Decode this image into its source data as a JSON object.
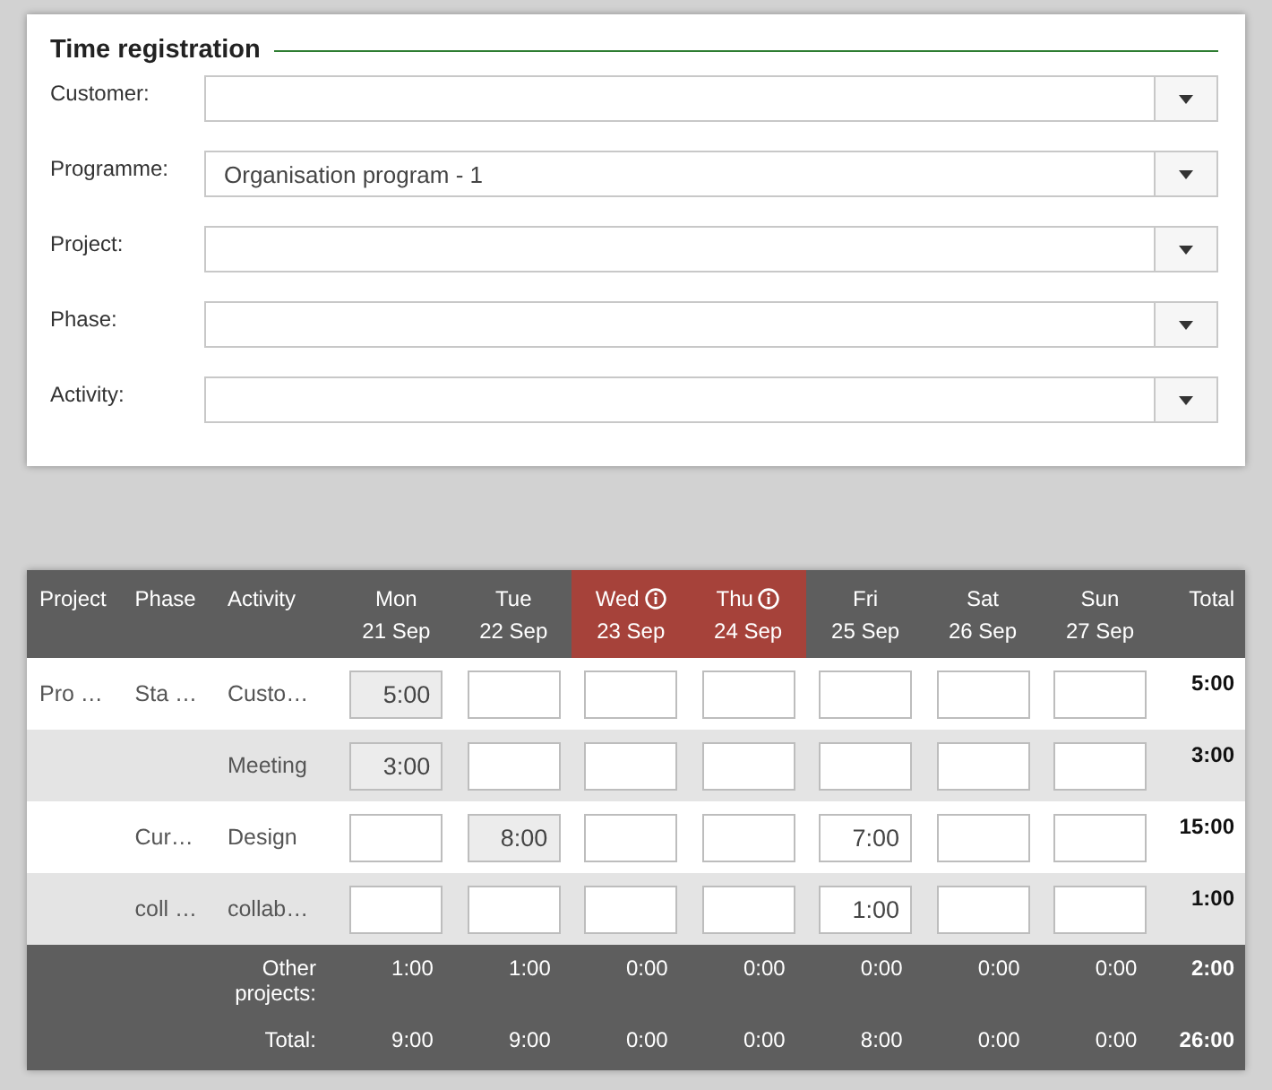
{
  "form": {
    "title": "Time registration",
    "fields": [
      {
        "label": "Customer:"
      },
      {
        "label": "Programme:",
        "value": "Organisation program - 1"
      },
      {
        "label": "Project:"
      },
      {
        "label": "Phase:"
      },
      {
        "label": "Activity:"
      }
    ]
  },
  "table": {
    "columns": {
      "project": "Project",
      "phase": "Phase",
      "activity": "Activity",
      "total": "Total"
    },
    "days": [
      {
        "day": "Mon",
        "date": "21 Sep",
        "highlighted": false,
        "info": false
      },
      {
        "day": "Tue",
        "date": "22 Sep",
        "highlighted": false,
        "info": false
      },
      {
        "day": "Wed",
        "date": "23 Sep",
        "highlighted": true,
        "info": true
      },
      {
        "day": "Thu",
        "date": "24 Sep",
        "highlighted": true,
        "info": true
      },
      {
        "day": "Fri",
        "date": "25 Sep",
        "highlighted": false,
        "info": false
      },
      {
        "day": "Sat",
        "date": "26 Sep",
        "highlighted": false,
        "info": false
      },
      {
        "day": "Sun",
        "date": "27 Sep",
        "highlighted": false,
        "info": false
      }
    ],
    "rows": [
      {
        "project": "Pro …",
        "phase": "Sta …",
        "activity": "Custo…",
        "cells": [
          {
            "value": "5:00",
            "locked": true
          },
          {
            "locked": false
          },
          {
            "locked": false
          },
          {
            "locked": false
          },
          {
            "locked": false
          },
          {
            "locked": false
          },
          {
            "locked": false
          }
        ],
        "total": "5:00"
      },
      {
        "activity": "Meeting",
        "cells": [
          {
            "value": "3:00",
            "locked": true
          },
          {
            "locked": false
          },
          {
            "locked": false
          },
          {
            "locked": false
          },
          {
            "locked": false
          },
          {
            "locked": false
          },
          {
            "locked": false
          }
        ],
        "total": "3:00"
      },
      {
        "phase": "Cur…",
        "activity": "Design",
        "cells": [
          {
            "locked": false
          },
          {
            "value": "8:00",
            "locked": true
          },
          {
            "locked": false
          },
          {
            "locked": false
          },
          {
            "value": "7:00",
            "locked": false
          },
          {
            "locked": false
          },
          {
            "locked": false
          }
        ],
        "total": "15:00"
      },
      {
        "phase": "coll …",
        "activity": "collab…",
        "cells": [
          {
            "locked": false
          },
          {
            "locked": false
          },
          {
            "locked": false
          },
          {
            "locked": false
          },
          {
            "value": "1:00",
            "locked": false
          },
          {
            "locked": false
          },
          {
            "locked": false
          }
        ],
        "total": "1:00"
      }
    ],
    "summary": [
      {
        "label": "Other projects:",
        "values": [
          "1:00",
          "1:00",
          "0:00",
          "0:00",
          "0:00",
          "0:00",
          "0:00"
        ],
        "total": "2:00"
      },
      {
        "label": "Total:",
        "values": [
          "9:00",
          "9:00",
          "0:00",
          "0:00",
          "8:00",
          "0:00",
          "0:00"
        ],
        "total": "26:00"
      }
    ]
  }
}
